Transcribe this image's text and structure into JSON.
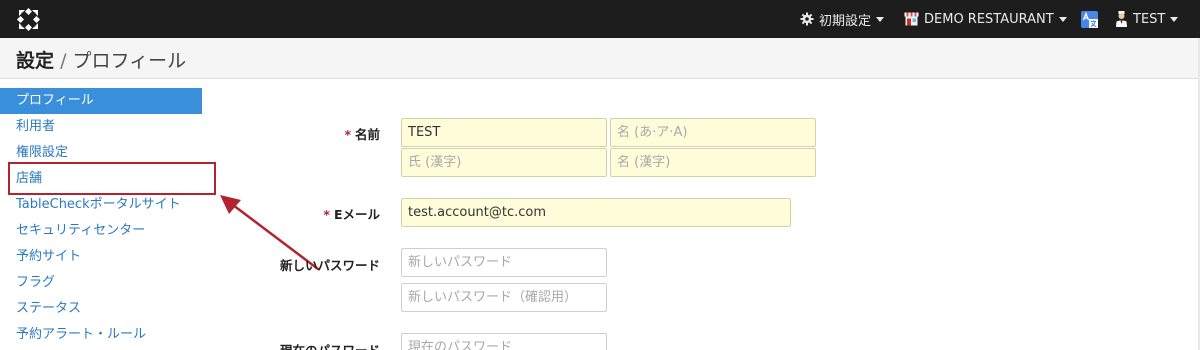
{
  "navbar": {
    "logo_icon": "tablecheck-logo-icon",
    "settings_menu": {
      "icon": "gear-icon",
      "label": "初期設定"
    },
    "restaurant_menu": {
      "icon": "restaurant-icon",
      "label": "DEMO RESTAURANT"
    },
    "language_menu": {
      "icon": "translate-icon"
    },
    "user_menu": {
      "icon": "user-icon",
      "label": "TEST"
    }
  },
  "header": {
    "title_main": "設定",
    "separator": "/",
    "title_sub": "プロフィール"
  },
  "sidebar": {
    "items": [
      {
        "label": "プロフィール",
        "active": true
      },
      {
        "label": "利用者"
      },
      {
        "label": "権限設定"
      },
      {
        "label": "店舗"
      },
      {
        "label": "TableCheckポータルサイト"
      },
      {
        "label": "セキュリティセンター"
      },
      {
        "label": "予約サイト"
      },
      {
        "label": "フラグ"
      },
      {
        "label": "ステータス"
      },
      {
        "label": "予約アラート・ルール"
      }
    ]
  },
  "annotation": {
    "highlight_color": "#b1242f"
  },
  "form": {
    "required_mark": "*",
    "name": {
      "label": "名前",
      "last_name_value": "TEST",
      "first_name_placeholder": "名 (あ·ア·A)",
      "last_name_kanji_placeholder": "氏 (漢字)",
      "first_name_kanji_placeholder": "名 (漢字)"
    },
    "email": {
      "label": "Eメール",
      "value": "test.account@tc.com"
    },
    "new_password": {
      "label": "新しいパスワード",
      "placeholder": "新しいパスワード",
      "confirm_placeholder": "新しいパスワード（確認用）"
    },
    "current_password": {
      "label": "現在のパスワード",
      "placeholder": "現在のパスワード"
    }
  },
  "colors": {
    "navbar_bg": "#1d1d1d",
    "active_item_bg": "#3a8fdb",
    "link": "#2a78c2",
    "input_highlight_bg": "#fffcda"
  }
}
